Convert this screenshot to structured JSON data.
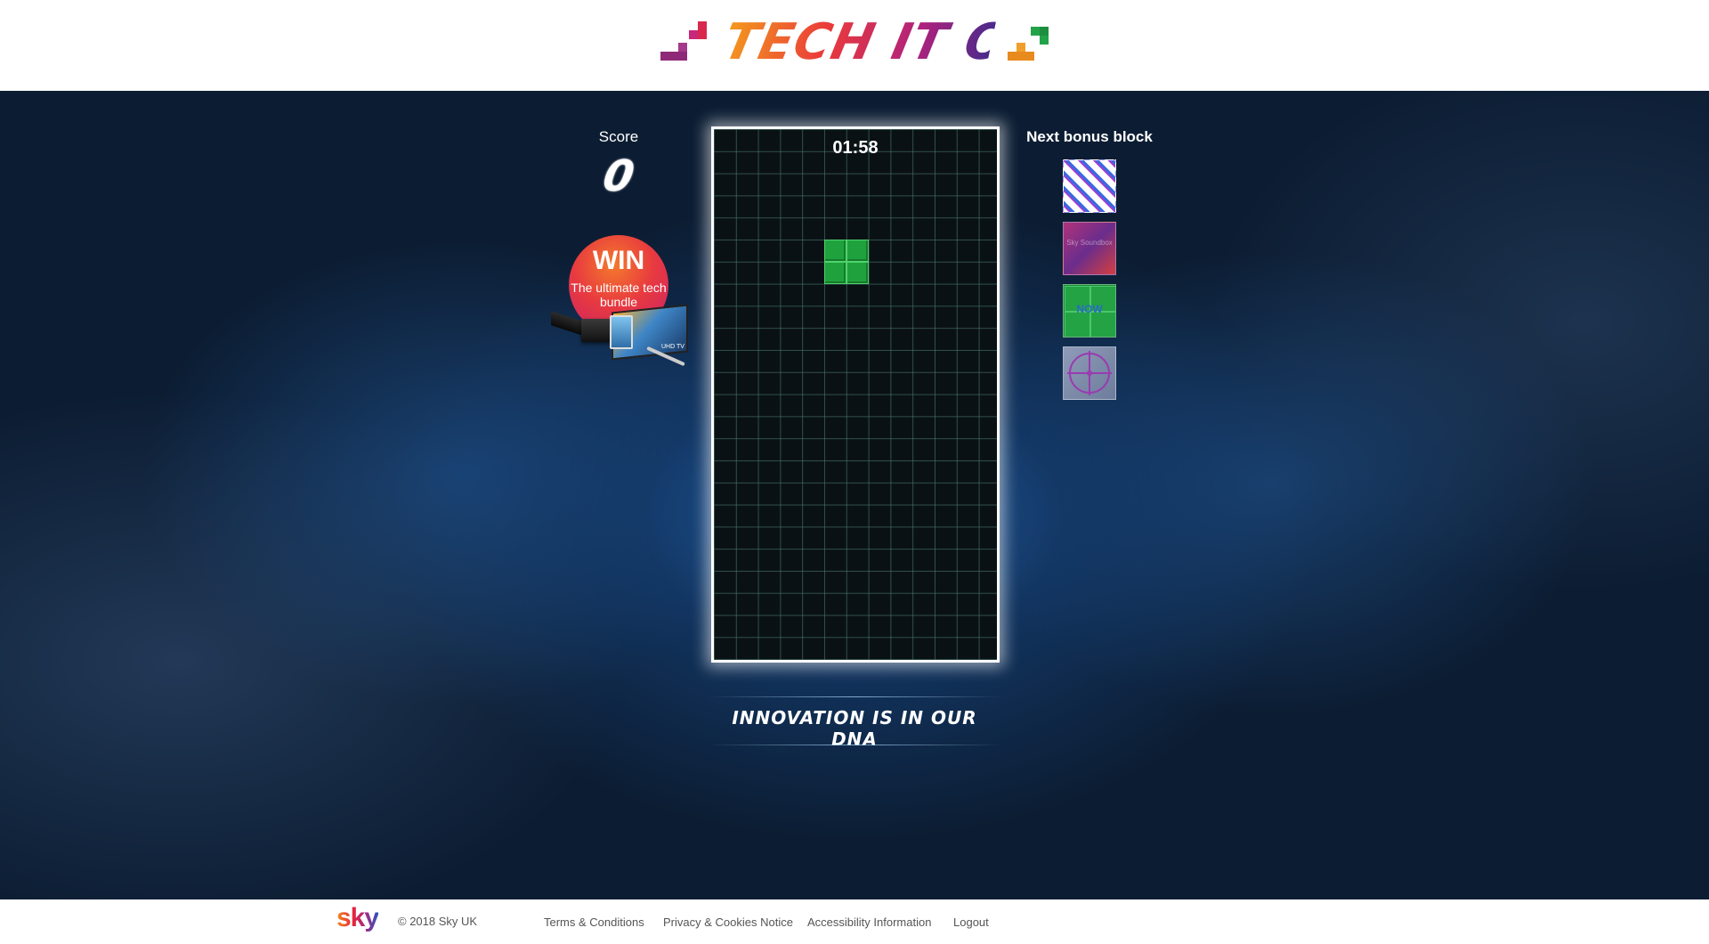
{
  "header": {
    "logo_text": "TECH IT OUT"
  },
  "score": {
    "label": "Score",
    "value": "0"
  },
  "promo": {
    "headline": "WIN",
    "subline": "The ultimate tech bundle",
    "tv_label": "UHD TV"
  },
  "game": {
    "timer": "01:58",
    "columns": 12,
    "rows": 24,
    "current_piece": "O",
    "piece_color": "#1fa23e"
  },
  "bonus": {
    "label": "Next bonus block",
    "blocks": [
      {
        "name": "pattern"
      },
      {
        "name": "sky-soundbox",
        "text": "Sky Soundbox"
      },
      {
        "name": "now-tv",
        "text": "NOW"
      },
      {
        "name": "target"
      }
    ]
  },
  "tagline": "INNOVATION IS IN OUR DNA",
  "footer": {
    "brand": "sky",
    "copyright": "© 2018 Sky UK",
    "links": [
      "Terms & Conditions",
      "Privacy & Cookies Notice",
      "Accessibility Information",
      "Logout"
    ]
  }
}
